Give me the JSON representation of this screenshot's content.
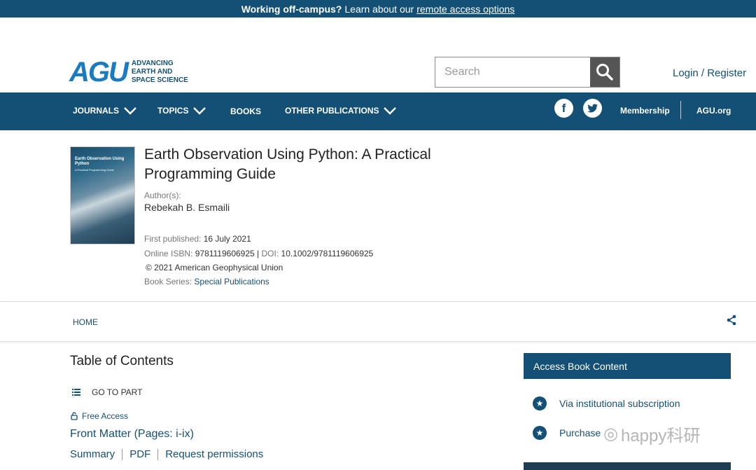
{
  "topbar": {
    "bold": "Working off-campus?",
    "text": "Learn about our",
    "link": "remote access options"
  },
  "header": {
    "logo_mark": "AGU",
    "logo_line1": "ADVANCING",
    "logo_line2": "EARTH AND",
    "logo_line3": "SPACE SCIENCE",
    "search_placeholder": "Search",
    "login": "Login / Register"
  },
  "nav": {
    "journals": "JOURNALS",
    "topics": "TOPICS",
    "books": "BOOKS",
    "other": "OTHER PUBLICATIONS",
    "facebook": "f",
    "membership": "Membership",
    "agu_org": "AGU.org"
  },
  "book": {
    "cover_title": "Earth Observation Using Python",
    "cover_subtitle": "A Practical Programming Guide",
    "title": "Earth Observation Using Python: A Practical Programming Guide",
    "author_label": "Author(s):",
    "author": "Rebekah B. Esmaili",
    "first_published_label": "First published:",
    "first_published": "16 July 2021",
    "isbn_label": "Online ISBN:",
    "isbn": "9781119606925",
    "doi_sep": "|",
    "doi_label": "DOI:",
    "doi": "10.1002/9781119606925",
    "copyright": "© 2021 American Geophysical Union",
    "series_label": "Book Series:",
    "series": "Special Publications"
  },
  "breadcrumb": {
    "home": "HOME"
  },
  "toc": {
    "title": "Table of Contents",
    "go_to_part": "GO TO PART",
    "free_access": "Free Access",
    "front_matter": "Front Matter (Pages: i-ix)",
    "summary": "Summary",
    "pdf": "PDF",
    "permissions": "Request permissions"
  },
  "access": {
    "title": "Access Book Content",
    "option1": "Via institutional subscription",
    "option2": "Purchase",
    "watermark": "happy科研"
  }
}
